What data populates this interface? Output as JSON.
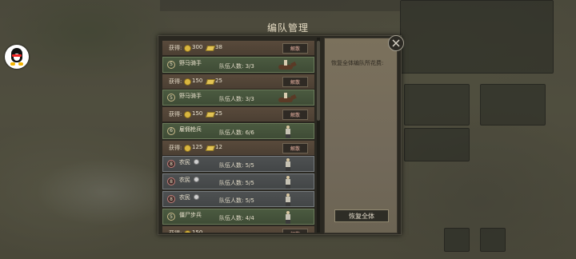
{
  "dialog": {
    "title": "编队管理",
    "right_panel_text": "恢复全体编队所花费:",
    "restore_all_label": "恢复全体"
  },
  "rows": [
    {
      "kind": "reward",
      "label": "获得:",
      "silver": "300",
      "gold": "38",
      "dismiss": "解散"
    },
    {
      "kind": "unit",
      "level": "5",
      "name": "野马骑手",
      "count": "队伍人数: 3/3",
      "style": "cav"
    },
    {
      "kind": "reward",
      "label": "获得:",
      "silver": "150",
      "gold": "25",
      "dismiss": "解散"
    },
    {
      "kind": "unit",
      "level": "5",
      "name": "野马骑手",
      "count": "队伍人数: 3/3",
      "style": "cav"
    },
    {
      "kind": "reward",
      "label": "获得:",
      "silver": "150",
      "gold": "25",
      "dismiss": "解散"
    },
    {
      "kind": "unit",
      "level": "6",
      "name": "雇佣枪兵",
      "count": "队伍人数: 6/6",
      "style": "cav"
    },
    {
      "kind": "reward",
      "label": "获得:",
      "silver": "125",
      "gold": "12",
      "dismiss": "解散"
    },
    {
      "kind": "unit",
      "level": "8",
      "name": "农民",
      "count": "队伍人数: 5/5",
      "style": "peasant"
    },
    {
      "kind": "unit",
      "level": "8",
      "name": "农民",
      "count": "队伍人数: 5/5",
      "style": "peasant"
    },
    {
      "kind": "unit",
      "level": "8",
      "name": "农民",
      "count": "队伍人数: 5/5",
      "style": "peasant"
    },
    {
      "kind": "unit",
      "level": "5",
      "name": "僵尸步兵",
      "count": "队伍人数: 4/4",
      "style": "cav"
    },
    {
      "kind": "reward",
      "label": "获得:",
      "silver": "150",
      "gold": "",
      "dismiss": "解散"
    }
  ]
}
